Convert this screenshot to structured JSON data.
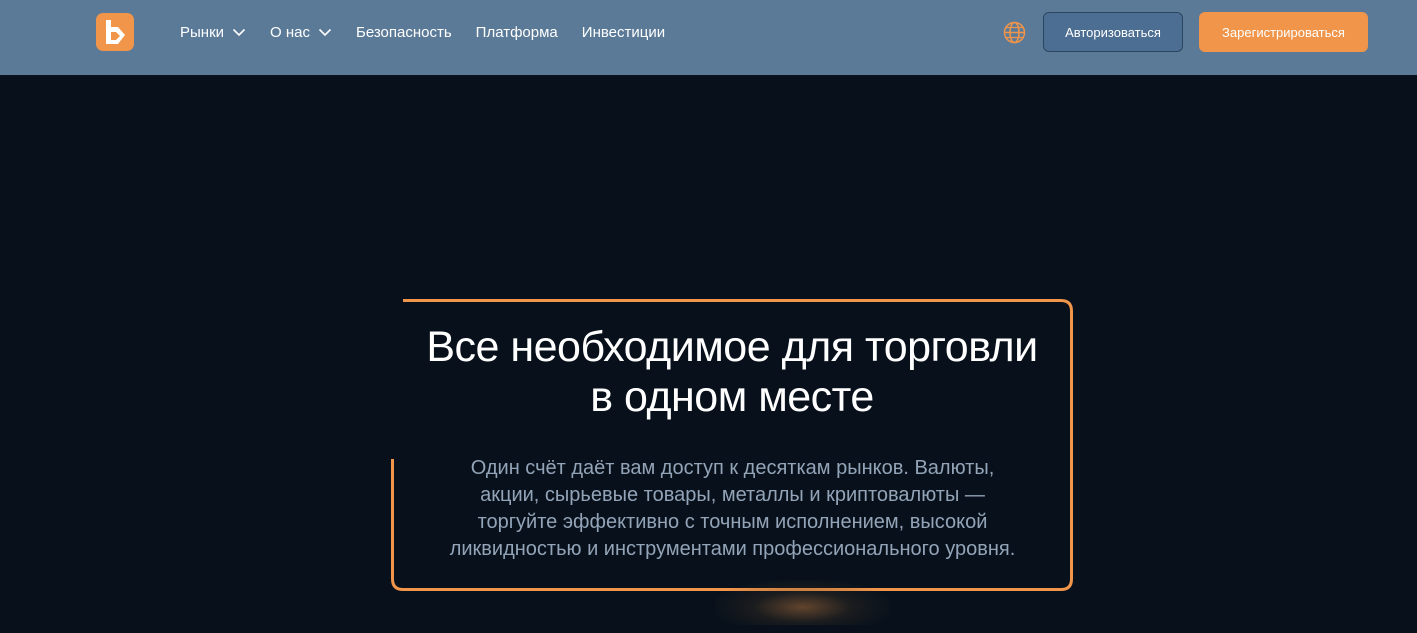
{
  "header": {
    "nav": [
      {
        "label": "Рынки",
        "has_dropdown": true
      },
      {
        "label": "О нас",
        "has_dropdown": true
      },
      {
        "label": "Безопасность",
        "has_dropdown": false
      },
      {
        "label": "Платформа",
        "has_dropdown": false
      },
      {
        "label": "Инвестиции",
        "has_dropdown": false
      }
    ],
    "language_icon": "globe-icon",
    "login_label": "Авторизоваться",
    "register_label": "Зарегистрироваться"
  },
  "hero": {
    "title_line1": "Все необходимое для торговли",
    "title_line2": "в одном месте",
    "subtitle_lines": [
      "Один счёт даёт вам доступ к десяткам рынков. Валюты,",
      "акции, сырьевые товары, металлы и криптовалюты —",
      "торгуйте эффективно с точным исполнением, высокой",
      "ликвидностью и инструментами профессионального уровня."
    ]
  },
  "colors": {
    "header_bg": "#5b7a98",
    "page_bg": "#08111b",
    "accent": "#f0954a",
    "login_button_bg": "#4d6e93",
    "subtitle_text": "#93a4b8"
  }
}
